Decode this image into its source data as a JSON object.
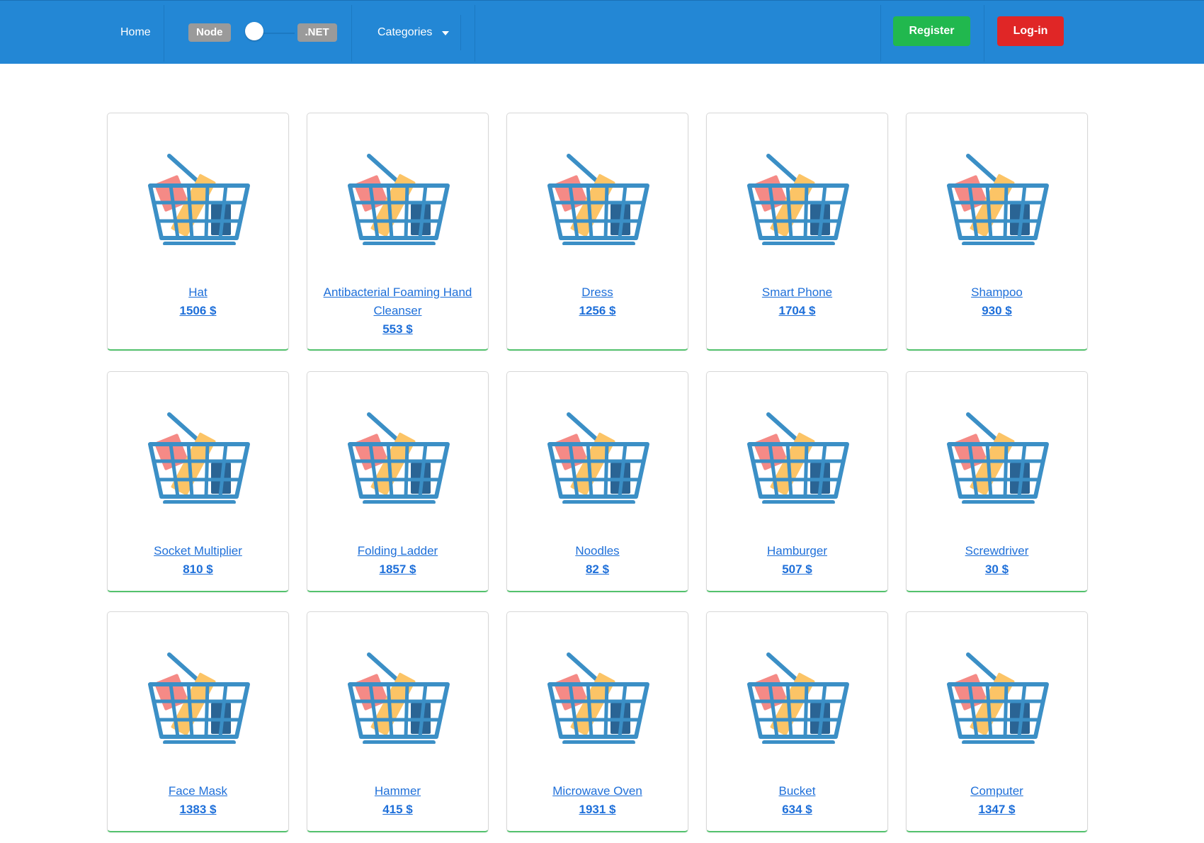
{
  "navbar": {
    "home_label": "Home",
    "toggle": {
      "left_label": "Node",
      "right_label": ".NET"
    },
    "categories_label": "Categories",
    "register_label": "Register",
    "login_label": "Log-in",
    "colors": {
      "bar": "#2387d5",
      "register": "#21b84e",
      "login": "#e02626",
      "pill": "#9a9a9a"
    }
  },
  "products": [
    {
      "name": "Hat",
      "price": "1506 $",
      "icon": "shopping-basket-icon"
    },
    {
      "name": "Antibacterial Foaming Hand Cleanser",
      "price": "553 $",
      "icon": "shopping-basket-icon"
    },
    {
      "name": "Dress",
      "price": "1256 $",
      "icon": "shopping-basket-icon"
    },
    {
      "name": "Smart Phone",
      "price": "1704 $",
      "icon": "shopping-basket-icon"
    },
    {
      "name": "Shampoo",
      "price": "930 $",
      "icon": "shopping-basket-icon"
    },
    {
      "name": "Socket Multiplier",
      "price": "810 $",
      "icon": "shopping-basket-icon"
    },
    {
      "name": "Folding Ladder",
      "price": "1857 $",
      "icon": "shopping-basket-icon"
    },
    {
      "name": "Noodles",
      "price": "82 $",
      "icon": "shopping-basket-icon"
    },
    {
      "name": "Hamburger",
      "price": "507 $",
      "icon": "shopping-basket-icon"
    },
    {
      "name": "Screwdriver",
      "price": "30 $",
      "icon": "shopping-basket-icon"
    },
    {
      "name": "Face Mask",
      "price": "1383 $",
      "icon": "shopping-basket-icon"
    },
    {
      "name": "Hammer",
      "price": "415 $",
      "icon": "shopping-basket-icon"
    },
    {
      "name": "Microwave Oven",
      "price": "1931 $",
      "icon": "shopping-basket-icon"
    },
    {
      "name": "Bucket",
      "price": "634 $",
      "icon": "shopping-basket-icon"
    },
    {
      "name": "Computer",
      "price": "1347 $",
      "icon": "shopping-basket-icon"
    }
  ],
  "accent_colors": {
    "link": "#1e6fd9",
    "card_bottom_border": "#53c26d"
  }
}
